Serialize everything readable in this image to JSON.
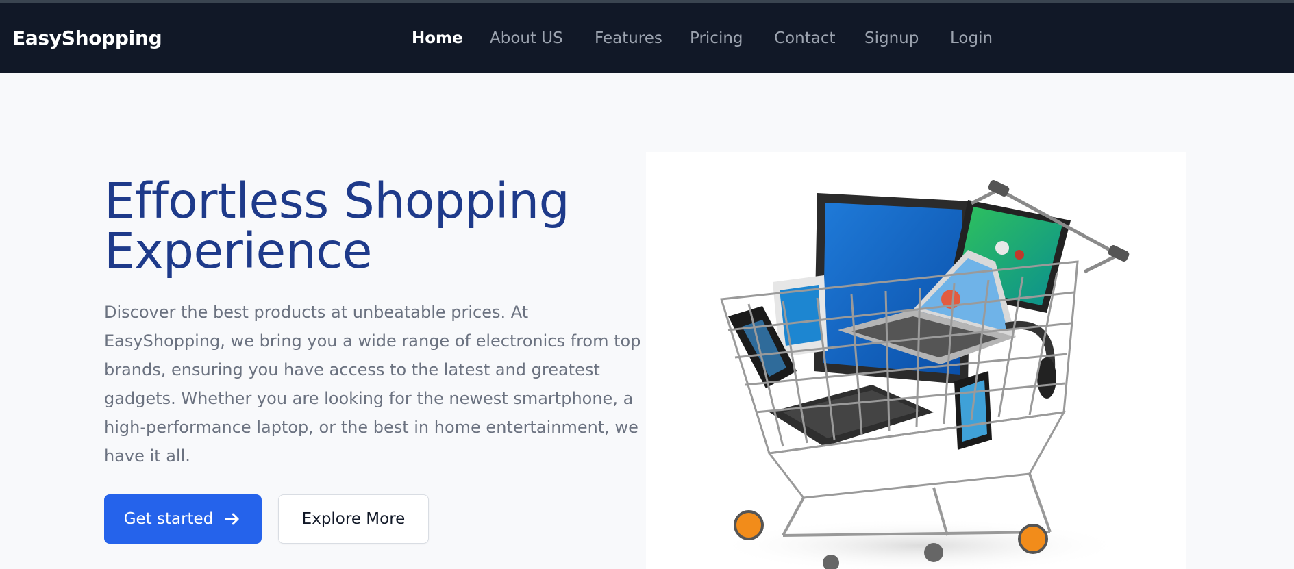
{
  "navbar": {
    "brand": "EasyShopping",
    "items": [
      {
        "label": "Home",
        "active": true
      },
      {
        "label": "About US",
        "active": false
      },
      {
        "label": "Features",
        "active": false
      },
      {
        "label": "Pricing",
        "active": false
      },
      {
        "label": "Contact",
        "active": false
      },
      {
        "label": "Signup",
        "active": false
      },
      {
        "label": "Login",
        "active": false
      }
    ]
  },
  "hero": {
    "title_line1": "Effortless Shopping",
    "title_line2": "Experience",
    "description": "Discover the best products at unbeatable prices. At EasyShopping, we bring you a wide range of electronics from top brands, ensuring you have access to the latest and greatest gadgets. Whether you are looking for the newest smartphone, a high-performance laptop, or the best in home entertainment, we have it all.",
    "primary_button": "Get started",
    "primary_button_icon": "arrow-right-icon",
    "secondary_button": "Explore More",
    "image": "shopping-cart-with-electronics"
  },
  "colors": {
    "navbar_bg": "#111827",
    "nav_active": "#ffffff",
    "nav_inactive": "#9ca3af",
    "title": "#1e3a8a",
    "description": "#6b7280",
    "primary": "#2563eb",
    "page_bg": "#f8f9fb"
  }
}
